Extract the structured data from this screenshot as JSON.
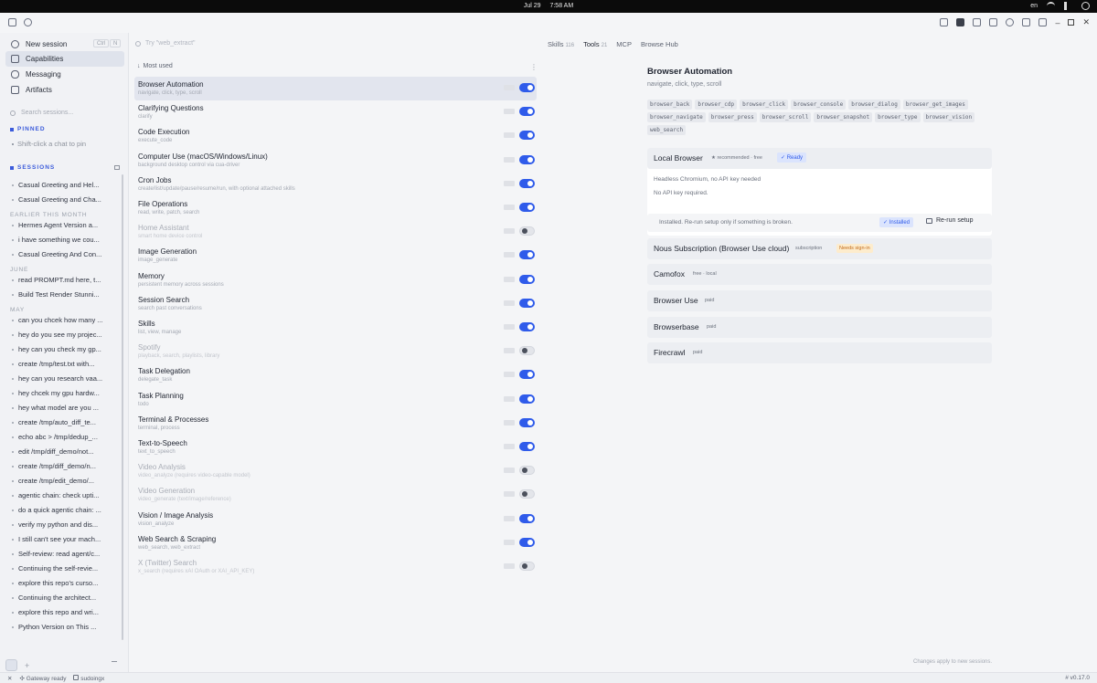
{
  "os": {
    "date": "Jul 29",
    "time": "7:58 AM",
    "lang": "en"
  },
  "sidebar": {
    "nav": [
      {
        "label": "New session",
        "icon": "plus-circle-icon"
      },
      {
        "label": "Capabilities",
        "icon": "capabilities-icon"
      },
      {
        "label": "Messaging",
        "icon": "chat-bubble-icon"
      },
      {
        "label": "Artifacts",
        "icon": "image-icon"
      }
    ],
    "shortcut": [
      "Ctrl",
      "N"
    ],
    "search_placeholder": "Search sessions...",
    "pinned_label": "PINNED",
    "pinned_hint": "Shift-click a chat to pin",
    "sessions_label": "SESSIONS",
    "groups": [
      {
        "label": "",
        "items": [
          "Casual Greeting and Hel...",
          "Casual Greeting and Cha..."
        ]
      },
      {
        "label": "EARLIER THIS MONTH",
        "items": [
          "Hermes Agent Version a...",
          "i have something we cou...",
          "Casual Greeting And Con..."
        ]
      },
      {
        "label": "JUNE",
        "items": [
          "read PROMPT.md here, t...",
          "Build Test Render Stunni..."
        ]
      },
      {
        "label": "MAY",
        "items": [
          "can you chcek how many ...",
          "hey do you see my projec...",
          "hey can you check my gp...",
          "create /tmp/test.txt with...",
          "hey can you research vaa...",
          "hey chcek my gpu hardw...",
          "hey what model are you ...",
          "create /tmp/auto_diff_te...",
          "echo abc > /tmp/dedup_...",
          "edit /tmp/diff_demo/not...",
          "create /tmp/diff_demo/n...",
          "create /tmp/edit_demo/...",
          "agentic chain: check upti...",
          "do a quick agentic chain: ...",
          "verify my python and dis...",
          "I still can't see your mach...",
          "Self-review: read agent/c...",
          "Continuing the self-revie...",
          "explore this repo's curso...",
          "Continuing the architect...",
          "explore this repo and wri...",
          "Python Version on This ..."
        ]
      }
    ]
  },
  "main": {
    "search_placeholder": "Try \"web_extract\"",
    "tabs": [
      {
        "label": "Skills",
        "count": "116"
      },
      {
        "label": "Tools",
        "count": "21"
      },
      {
        "label": "MCP",
        "count": ""
      },
      {
        "label": "Browse Hub",
        "count": ""
      }
    ],
    "sort_label": "Most used",
    "tools": [
      {
        "name": "Browser Automation",
        "desc": "navigate, click, type, scroll",
        "enabled": true
      },
      {
        "name": "Clarifying Questions",
        "desc": "clarify",
        "enabled": true
      },
      {
        "name": "Code Execution",
        "desc": "execute_code",
        "enabled": true
      },
      {
        "name": "Computer Use (macOS/Windows/Linux)",
        "desc": "background desktop control via cua-driver",
        "enabled": true
      },
      {
        "name": "Cron Jobs",
        "desc": "create/list/update/pause/resume/run, with optional attached skills",
        "enabled": true
      },
      {
        "name": "File Operations",
        "desc": "read, write, patch, search",
        "enabled": true
      },
      {
        "name": "Home Assistant",
        "desc": "smart home device control",
        "enabled": false
      },
      {
        "name": "Image Generation",
        "desc": "image_generate",
        "enabled": true
      },
      {
        "name": "Memory",
        "desc": "persistent memory across sessions",
        "enabled": true
      },
      {
        "name": "Session Search",
        "desc": "search past conversations",
        "enabled": true
      },
      {
        "name": "Skills",
        "desc": "list, view, manage",
        "enabled": true
      },
      {
        "name": "Spotify",
        "desc": "playback, search, playlists, library",
        "enabled": false
      },
      {
        "name": "Task Delegation",
        "desc": "delegate_task",
        "enabled": true
      },
      {
        "name": "Task Planning",
        "desc": "todo",
        "enabled": true
      },
      {
        "name": "Terminal & Processes",
        "desc": "terminal, process",
        "enabled": true
      },
      {
        "name": "Text-to-Speech",
        "desc": "text_to_speech",
        "enabled": true
      },
      {
        "name": "Video Analysis",
        "desc": "video_analyze (requires video-capable model)",
        "enabled": false
      },
      {
        "name": "Video Generation",
        "desc": "video_generate (text/image/reference)",
        "enabled": false
      },
      {
        "name": "Vision / Image Analysis",
        "desc": "vision_analyze",
        "enabled": true
      },
      {
        "name": "Web Search & Scraping",
        "desc": "web_search, web_extract",
        "enabled": true
      },
      {
        "name": "X (Twitter) Search",
        "desc": "x_search (requires xAI OAuth or XAI_API_KEY)",
        "enabled": false
      }
    ],
    "footer_note": "Changes apply to new sessions."
  },
  "detail": {
    "title": "Browser Automation",
    "subtitle": "navigate, click, type, scroll",
    "functions": [
      "browser_back",
      "browser_cdp",
      "browser_click",
      "browser_console",
      "browser_dialog",
      "browser_get_images",
      "browser_navigate",
      "browser_press",
      "browser_scroll",
      "browser_snapshot",
      "browser_type",
      "browser_vision",
      "web_search"
    ],
    "local": {
      "name": "Local Browser",
      "meta": "★ recommended · free",
      "ready": "✓ Ready",
      "line1": "Headless Chromium, no API key needed",
      "line2": "No API key required.",
      "install_msg": "Installed. Re-run setup only if something is broken.",
      "installed": "✓ Installed",
      "rerun": "Re-run setup"
    },
    "providers": [
      {
        "name": "Nous Subscription (Browser Use cloud)",
        "meta": "subscription",
        "badge": "Needs sign-in"
      },
      {
        "name": "Camofox",
        "meta": "free · local",
        "badge": ""
      },
      {
        "name": "Browser Use",
        "meta": "paid",
        "badge": ""
      },
      {
        "name": "Browserbase",
        "meta": "paid",
        "badge": ""
      },
      {
        "name": "Firecrawl",
        "meta": "paid",
        "badge": ""
      }
    ]
  },
  "status": {
    "gateway": "Gateway",
    "gateway_state": "ready",
    "user": "sudoingx",
    "version": "v0.17.0"
  }
}
